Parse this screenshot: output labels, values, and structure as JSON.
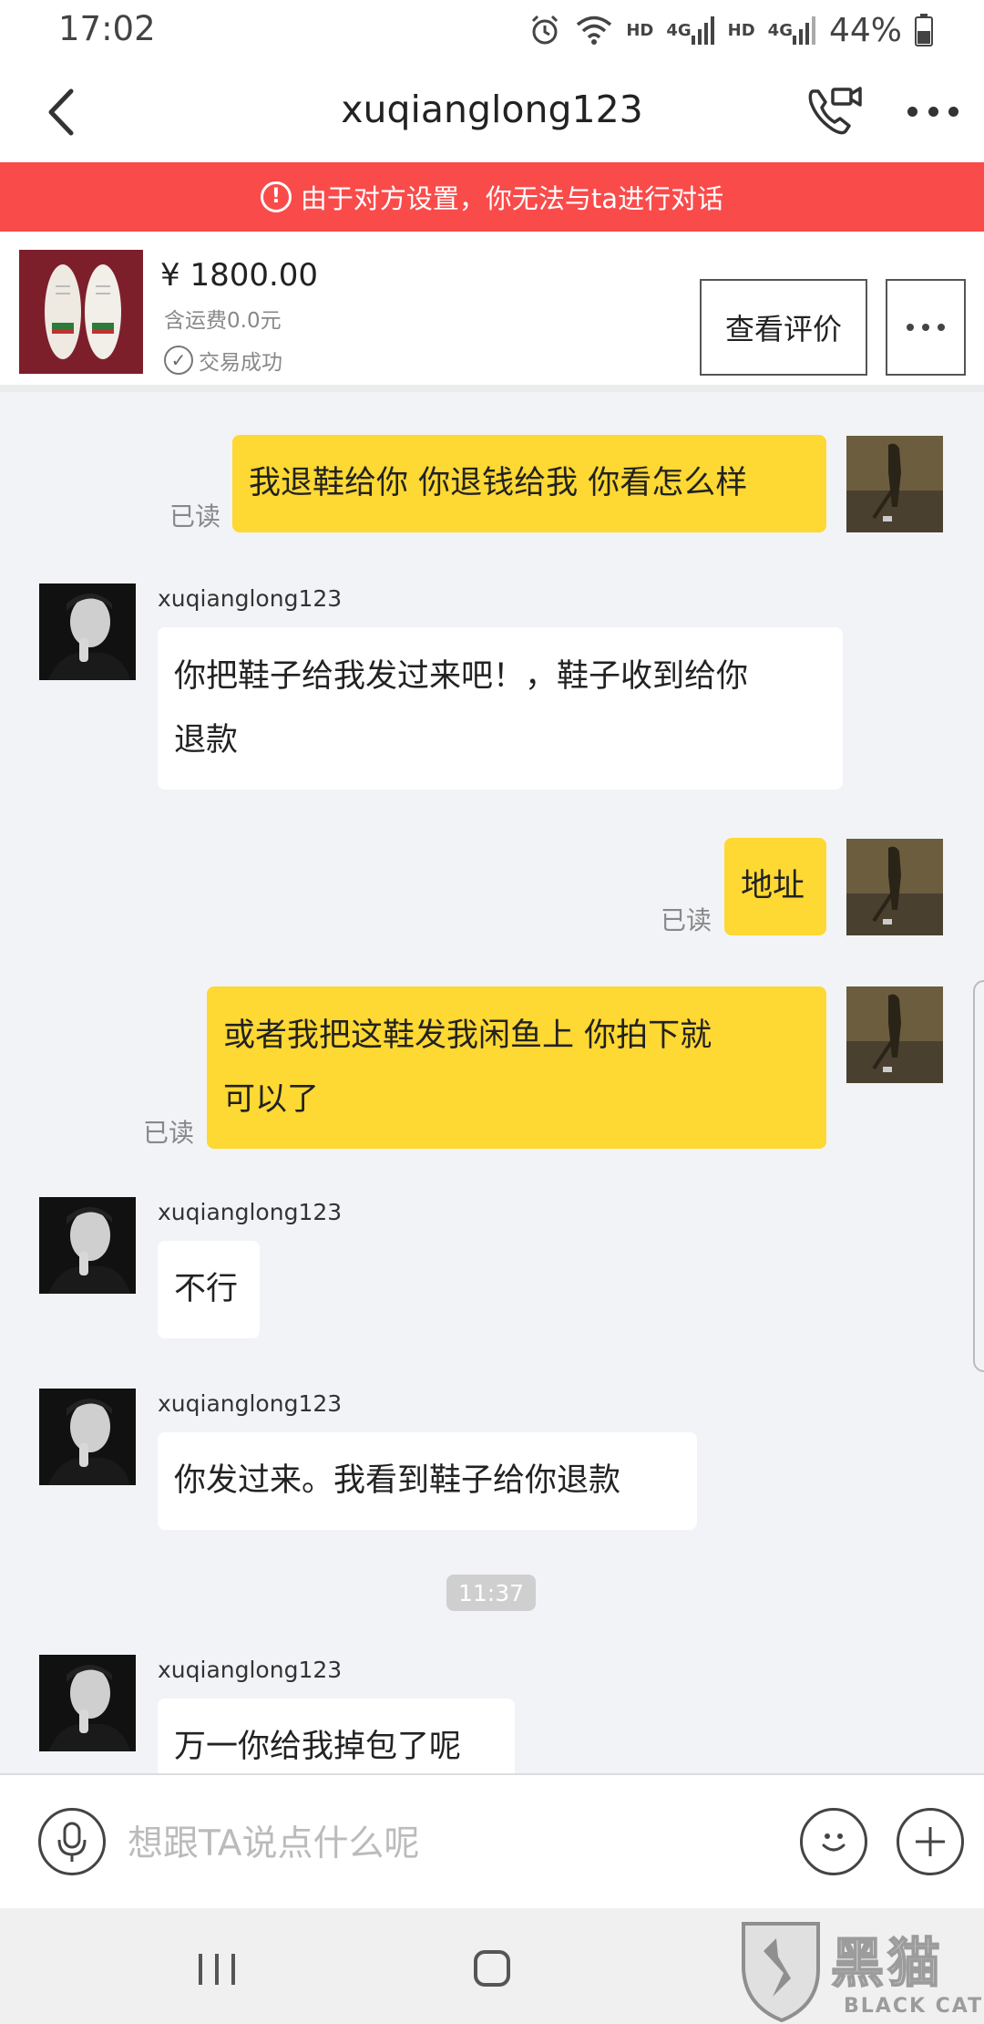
{
  "status_bar": {
    "time": "17:02",
    "network_label_1": "HD",
    "network_type_1": "4G",
    "network_label_2": "HD",
    "network_type_2": "4G",
    "battery": "44%",
    "icons": [
      "alarm-icon",
      "wifi-icon",
      "signal-icon",
      "battery-icon"
    ]
  },
  "header": {
    "title": "xuqianglong123",
    "icons": [
      "back-icon",
      "video-call-icon",
      "more-icon"
    ]
  },
  "warning": {
    "text": "由于对方设置，你无法与ta进行对话",
    "color": "#fa4b4b"
  },
  "product": {
    "price": "¥ 1800.00",
    "shipping": "含运费0.0元",
    "status": "交易成功",
    "review_button": "查看评价"
  },
  "chat": {
    "contact_name": "xuqianglong123",
    "messages": [
      {
        "from": "me",
        "text": "我退鞋给你 你退钱给我 你看怎么样",
        "read": "已读"
      },
      {
        "from": "them",
        "sender": "xuqianglong123",
        "lines": [
          "你把鞋子给我发过来吧！，鞋子收到给你",
          "退款"
        ]
      },
      {
        "from": "me",
        "text": "地址",
        "read": "已读"
      },
      {
        "from": "me",
        "lines": [
          "或者我把这鞋发我闲鱼上 你拍下就",
          "可以了"
        ],
        "read": "已读"
      },
      {
        "from": "them",
        "sender": "xuqianglong123",
        "text": "不行"
      },
      {
        "from": "them",
        "sender": "xuqianglong123",
        "text": "你发过来。我看到鞋子给你退款"
      },
      {
        "from": "time",
        "text": "11:37"
      },
      {
        "from": "them",
        "sender": "xuqianglong123",
        "text": "万一你给我掉包了呢"
      }
    ],
    "bubble_color_me": "#fed833",
    "bubble_color_them": "#ffffff"
  },
  "input": {
    "placeholder": "想跟TA说点什么呢",
    "icons": [
      "microphone-icon",
      "emoji-icon",
      "plus-icon"
    ]
  },
  "watermark": {
    "text": "黑猫",
    "sub": "BLACK CAT"
  }
}
